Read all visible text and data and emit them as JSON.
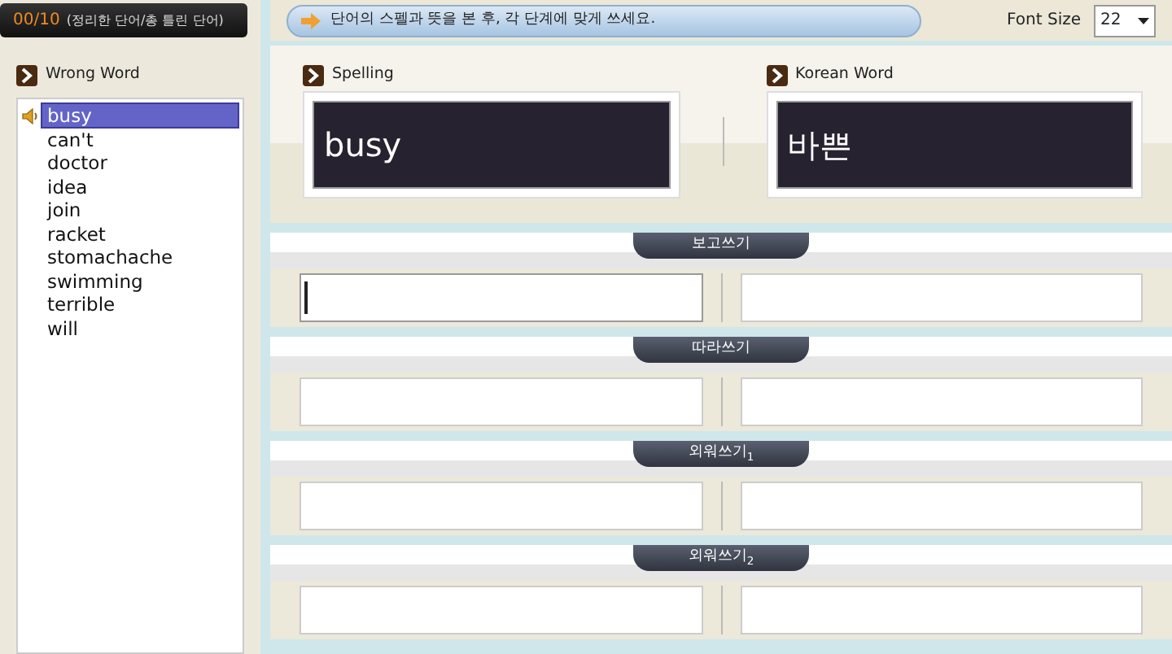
{
  "counter": {
    "score": "00/10",
    "note": "(정리한 단어/총 틀린 단어)"
  },
  "instruction": "단어의 스펠과 뜻을 본 후, 각 단계에 맞게 쓰세요.",
  "font_size": {
    "label": "Font Size",
    "value": "22"
  },
  "word_list": {
    "title": "Wrong Word",
    "items": [
      {
        "text": "busy",
        "selected": true
      },
      {
        "text": "can't",
        "selected": false
      },
      {
        "text": "doctor",
        "selected": false
      },
      {
        "text": "idea",
        "selected": false
      },
      {
        "text": "join",
        "selected": false
      },
      {
        "text": "racket",
        "selected": false
      },
      {
        "text": "stomachache",
        "selected": false
      },
      {
        "text": "swimming",
        "selected": false
      },
      {
        "text": "terrible",
        "selected": false
      },
      {
        "text": "will",
        "selected": false
      }
    ]
  },
  "spelling": {
    "title": "Spelling",
    "value": "busy"
  },
  "korean": {
    "title": "Korean Word",
    "value": "바쁜"
  },
  "stages": [
    {
      "title": "보고쓰기",
      "fields": [
        {
          "focused": true
        },
        {
          "focused": false
        }
      ]
    },
    {
      "title": "따라쓰기",
      "fields": [
        {
          "focused": false
        },
        {
          "focused": false
        }
      ]
    },
    {
      "title": "외워쓰기$_{1}$",
      "fields": [
        {
          "focused": false
        },
        {
          "focused": false
        }
      ]
    },
    {
      "title": "외워쓰기$_{2}$",
      "fields": [
        {
          "focused": false
        },
        {
          "focused": false
        }
      ]
    }
  ]
}
